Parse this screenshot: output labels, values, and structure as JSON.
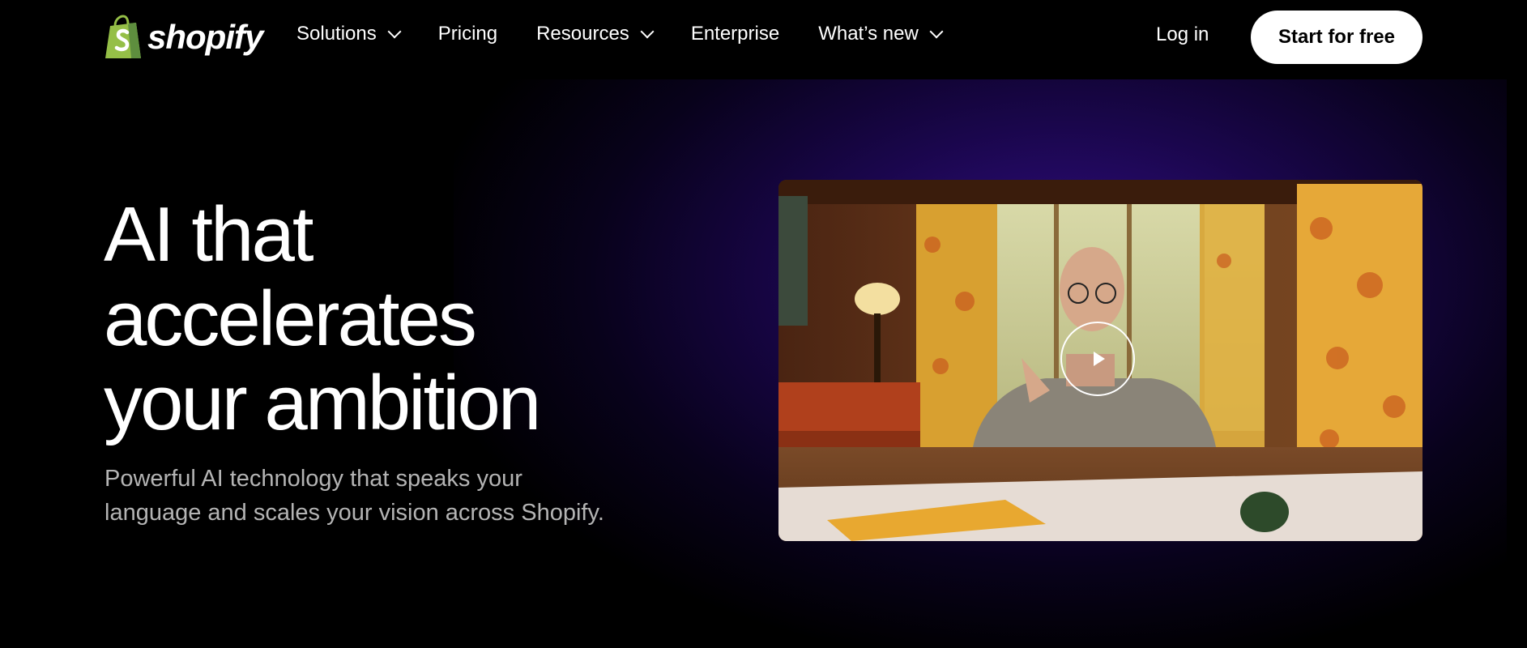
{
  "brand": {
    "name": "shopify",
    "accent": "#95BF47"
  },
  "nav": {
    "items": [
      {
        "label": "Solutions",
        "has_dropdown": true
      },
      {
        "label": "Pricing",
        "has_dropdown": false
      },
      {
        "label": "Resources",
        "has_dropdown": true
      },
      {
        "label": "Enterprise",
        "has_dropdown": false
      },
      {
        "label": "What’s new",
        "has_dropdown": true
      }
    ],
    "login_label": "Log in",
    "cta_label": "Start for free"
  },
  "hero": {
    "headline_lines": [
      "AI that",
      "accelerates",
      "your ambition"
    ],
    "subtitle_lines": [
      "Powerful AI technology that speaks your",
      "language and scales your vision across Shopify."
    ],
    "video": {
      "play_icon": "play-icon"
    }
  },
  "colors": {
    "background": "#000000",
    "glow": "#2a0a78",
    "cta_bg": "#ffffff"
  }
}
